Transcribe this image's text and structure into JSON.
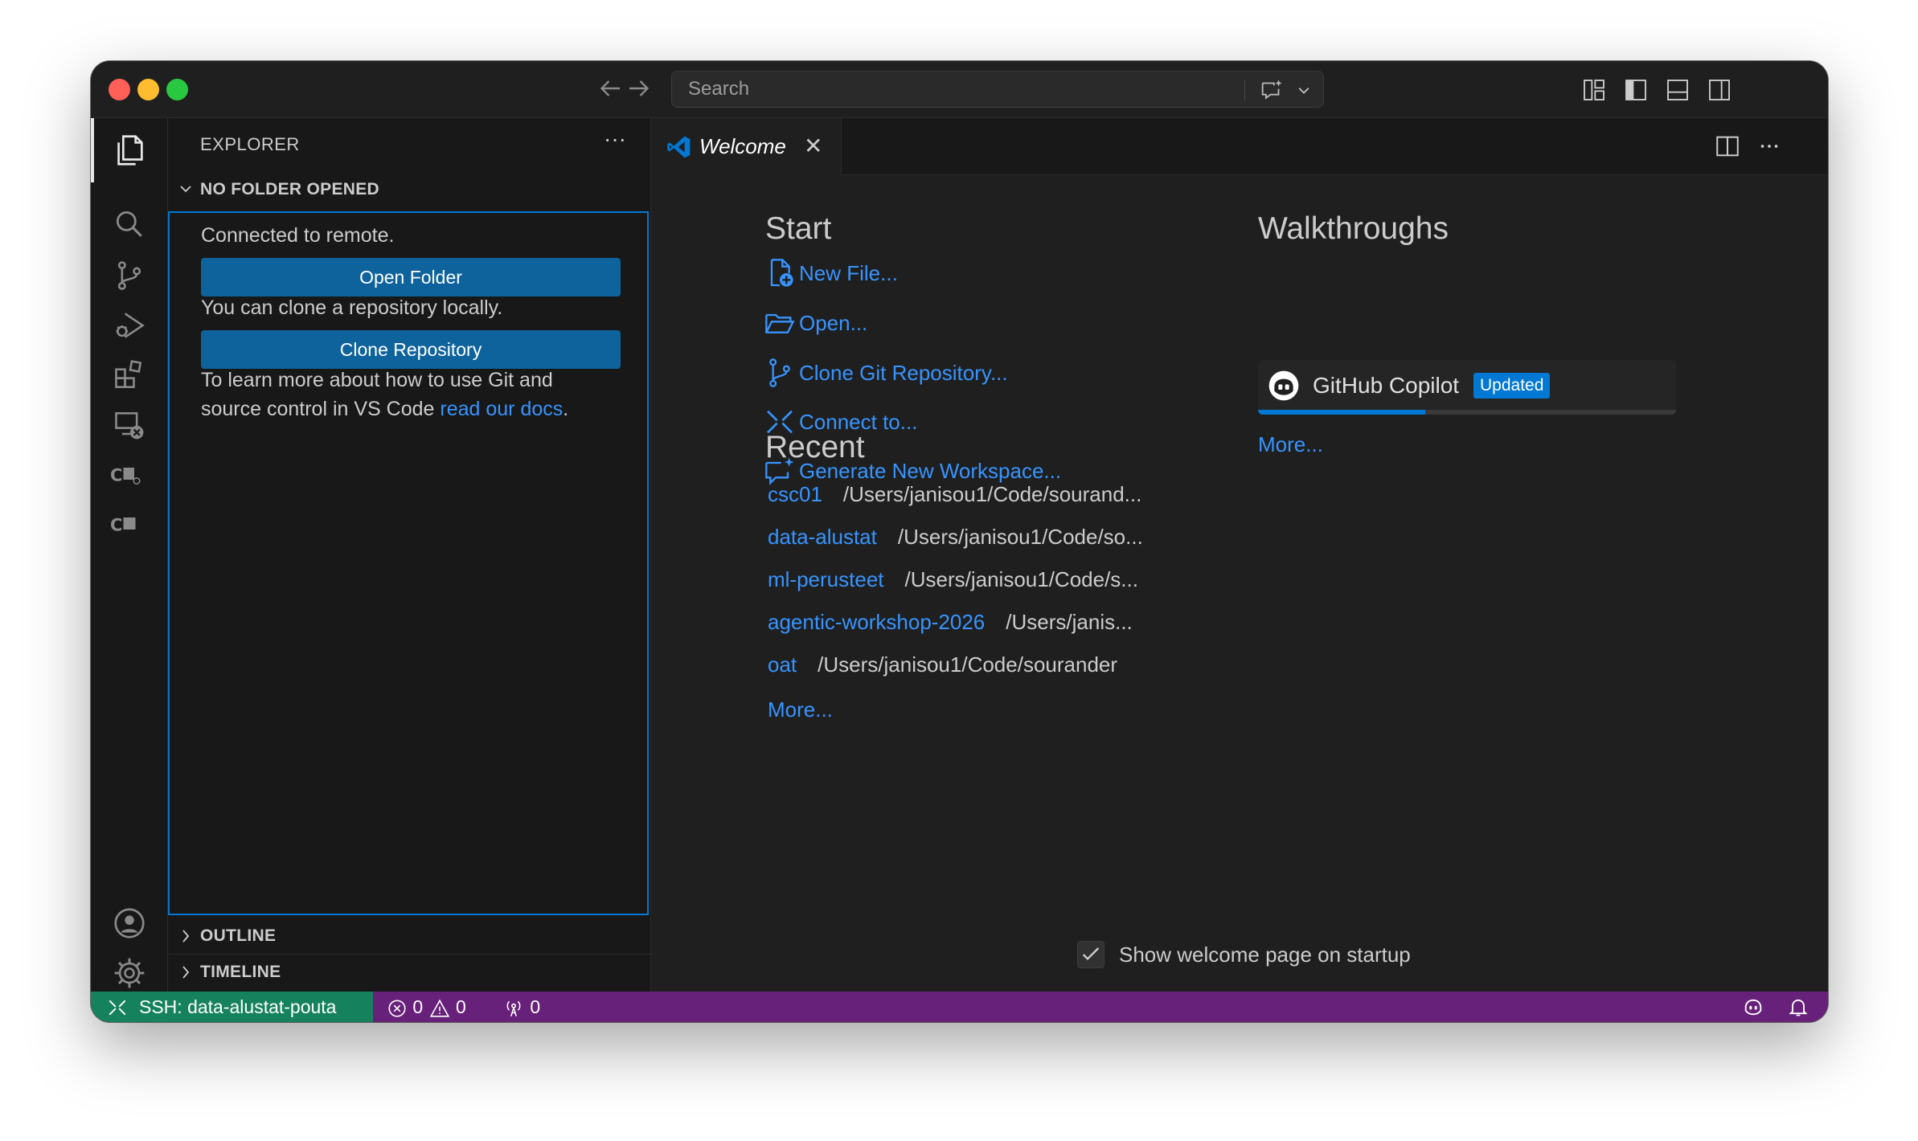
{
  "titlebar": {
    "search_placeholder": "Search"
  },
  "sidebar": {
    "title": "EXPLORER",
    "more_label": "···",
    "no_folder": {
      "header": "NO FOLDER OPENED",
      "connected_text": "Connected to remote.",
      "open_folder_label": "Open Folder",
      "clone_text": "You can clone a repository locally.",
      "clone_label": "Clone Repository",
      "learn_text_1": "To learn more about how to use Git and",
      "learn_text_2": "source control in VS Code ",
      "learn_link": "read our docs",
      "learn_text_end": "."
    },
    "outline_header": "OUTLINE",
    "timeline_header": "TIMELINE"
  },
  "tabs": [
    {
      "label": "Welcome",
      "close": "✕"
    }
  ],
  "welcome": {
    "start_heading": "Start",
    "start_items": [
      {
        "label": "New File...",
        "icon": "new-file-icon"
      },
      {
        "label": "Open...",
        "icon": "folder-open-icon"
      },
      {
        "label": "Clone Git Repository...",
        "icon": "source-control-icon"
      },
      {
        "label": "Connect to...",
        "icon": "remote-icon"
      },
      {
        "label": "Generate New Workspace...",
        "icon": "sparkle-chat-icon"
      }
    ],
    "recent_heading": "Recent",
    "recent_items": [
      {
        "name": "csc01",
        "path": "/Users/janisou1/Code/sourand..."
      },
      {
        "name": "data-alustat",
        "path": "/Users/janisou1/Code/so..."
      },
      {
        "name": "ml-perusteet",
        "path": "/Users/janisou1/Code/s..."
      },
      {
        "name": "agentic-workshop-2026",
        "path": "/Users/janis..."
      },
      {
        "name": "oat",
        "path": "/Users/janisou1/Code/sourander"
      }
    ],
    "recent_more": "More...",
    "walkthroughs_heading": "Walkthroughs",
    "walkthrough": {
      "title": "GitHub Copilot",
      "badge": "Updated",
      "progress": 0.4
    },
    "walkthroughs_more": "More...",
    "show_on_startup": "Show welcome page on startup",
    "show_on_startup_checked": true
  },
  "statusbar": {
    "remote": "SSH: data-alustat-pouta",
    "errors": "0",
    "warnings": "0",
    "ports": "0"
  },
  "colors": {
    "accent": "#0078d4",
    "link": "#3794ff",
    "statusbar": "#68217a",
    "remote": "#16825d"
  }
}
